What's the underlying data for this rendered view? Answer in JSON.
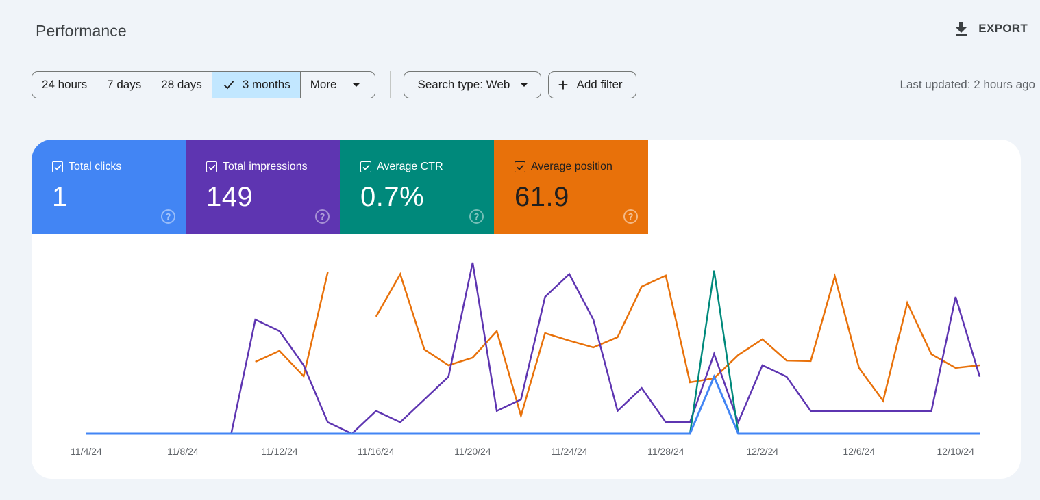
{
  "header": {
    "title": "Performance",
    "export_label": "EXPORT",
    "export_icon": "download-icon"
  },
  "toolbar": {
    "date_ranges": [
      {
        "label": "24 hours",
        "selected": false
      },
      {
        "label": "7 days",
        "selected": false
      },
      {
        "label": "28 days",
        "selected": false
      },
      {
        "label": "3 months",
        "selected": true
      },
      {
        "label": "More",
        "selected": false
      }
    ],
    "search_type_label": "Search type: Web",
    "add_filter_label": "Add filter",
    "last_updated": "Last updated: 2 hours ago"
  },
  "metrics": [
    {
      "label": "Total clicks",
      "value": "1",
      "checked": true,
      "color": "#4285f4"
    },
    {
      "label": "Total impressions",
      "value": "149",
      "checked": true,
      "color": "#5e35b1"
    },
    {
      "label": "Average CTR",
      "value": "0.7%",
      "checked": true,
      "color": "#00897b"
    },
    {
      "label": "Average position",
      "value": "61.9",
      "checked": true,
      "color": "#e8710a"
    }
  ],
  "chart_data": {
    "type": "line",
    "x": [
      "11/4/24",
      "11/5/24",
      "11/6/24",
      "11/7/24",
      "11/8/24",
      "11/9/24",
      "11/10/24",
      "11/11/24",
      "11/12/24",
      "11/13/24",
      "11/14/24",
      "11/15/24",
      "11/16/24",
      "11/17/24",
      "11/18/24",
      "11/19/24",
      "11/20/24",
      "11/21/24",
      "11/22/24",
      "11/23/24",
      "11/24/24",
      "11/25/24",
      "11/26/24",
      "11/27/24",
      "11/28/24",
      "11/29/24",
      "11/30/24",
      "12/1/24",
      "12/2/24",
      "12/3/24",
      "12/4/24",
      "12/5/24",
      "12/6/24",
      "12/7/24",
      "12/8/24",
      "12/9/24",
      "12/10/24",
      "12/11/24"
    ],
    "tick_labels": [
      "11/4/24",
      "11/8/24",
      "11/12/24",
      "11/16/24",
      "11/20/24",
      "11/24/24",
      "11/28/24",
      "12/2/24",
      "12/6/24",
      "12/10/24"
    ],
    "tick_indices": [
      0,
      4,
      8,
      12,
      16,
      20,
      24,
      28,
      32,
      36
    ],
    "series": [
      {
        "name": "Average position",
        "color": "#e8710a",
        "inverted": true,
        "ylim": [
          10,
          100
        ],
        "values": [
          null,
          null,
          null,
          null,
          null,
          null,
          null,
          62.2,
          56.4,
          69.8,
          15.0,
          null,
          38.4,
          16.1,
          55.7,
          64.0,
          60.0,
          46.0,
          90.6,
          47.1,
          51.0,
          54.6,
          49.2,
          22.6,
          16.8,
          73.0,
          70.8,
          58.6,
          50.3,
          61.5,
          61.8,
          17.2,
          65.4,
          82.7,
          31.2,
          58.2,
          65.4,
          64.0
        ]
      },
      {
        "name": "Total impressions",
        "color": "#5e35b1",
        "ylim": [
          0,
          15
        ],
        "values": [
          0,
          0,
          0,
          0,
          0,
          0,
          0,
          10,
          9,
          6,
          1,
          0,
          2,
          1,
          3,
          5,
          15,
          2,
          3,
          12,
          14,
          10,
          2,
          4,
          1,
          1,
          7,
          1,
          6,
          5,
          2,
          2,
          2,
          2,
          2,
          2,
          12,
          5
        ]
      },
      {
        "name": "Average CTR",
        "color": "#00897b",
        "ylim": [
          0,
          15
        ],
        "values": [
          0,
          0,
          0,
          0,
          0,
          0,
          0,
          0,
          0,
          0,
          0,
          0,
          0,
          0,
          0,
          0,
          0,
          0,
          0,
          0,
          0,
          0,
          0,
          0,
          0,
          0,
          14.3,
          0,
          0,
          0,
          0,
          0,
          0,
          0,
          0,
          0,
          0,
          0
        ]
      },
      {
        "name": "Total clicks",
        "color": "#4285f4",
        "ylim": [
          0,
          3
        ],
        "values": [
          0,
          0,
          0,
          0,
          0,
          0,
          0,
          0,
          0,
          0,
          0,
          0,
          0,
          0,
          0,
          0,
          0,
          0,
          0,
          0,
          0,
          0,
          0,
          0,
          0,
          0,
          1,
          0,
          0,
          0,
          0,
          0,
          0,
          0,
          0,
          0,
          0,
          0
        ]
      }
    ],
    "grid": false,
    "legend": "top-left metric cards"
  }
}
